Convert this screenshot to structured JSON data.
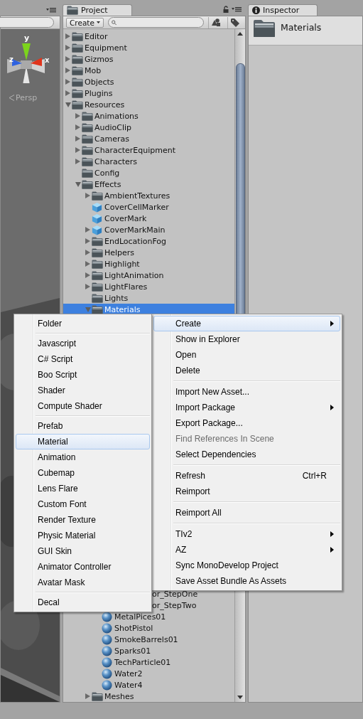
{
  "scene": {
    "axes": [
      {
        "label": "y"
      },
      {
        "label": "z"
      },
      {
        "label": "x"
      }
    ],
    "view_mode": "Persp"
  },
  "project": {
    "tab": "Project",
    "create_button": "Create",
    "tree": [
      {
        "name": "Editor",
        "kind": "folder",
        "expanded": false,
        "selected": false
      },
      {
        "name": "Equipment",
        "kind": "folder",
        "expanded": false,
        "selected": false
      },
      {
        "name": "Gizmos",
        "kind": "folder",
        "expanded": false,
        "selected": false
      },
      {
        "name": "Mob",
        "kind": "folder",
        "expanded": false,
        "selected": false
      },
      {
        "name": "Objects",
        "kind": "folder",
        "expanded": false,
        "selected": false
      },
      {
        "name": "Plugins",
        "kind": "folder",
        "expanded": false,
        "selected": false
      },
      {
        "name": "Resources",
        "kind": "folder",
        "expanded": true,
        "selected": false,
        "children": [
          {
            "name": "Animations",
            "kind": "folder",
            "expanded": false,
            "selected": false
          },
          {
            "name": "AudioClip",
            "kind": "folder",
            "expanded": false,
            "selected": false
          },
          {
            "name": "Cameras",
            "kind": "folder",
            "expanded": false,
            "selected": false
          },
          {
            "name": "CharacterEquipment",
            "kind": "folder",
            "expanded": false,
            "selected": false
          },
          {
            "name": "Characters",
            "kind": "folder",
            "expanded": false,
            "selected": false
          },
          {
            "name": "Config",
            "kind": "folder",
            "selected": false
          },
          {
            "name": "Effects",
            "kind": "folder",
            "expanded": true,
            "selected": false,
            "children": [
              {
                "name": "AmbientTextures",
                "kind": "folder",
                "expanded": false,
                "selected": false
              },
              {
                "name": "CoverCellMarker",
                "kind": "prefab",
                "selected": false
              },
              {
                "name": "CoverMark",
                "kind": "prefab",
                "selected": false
              },
              {
                "name": "CoverMarkMain",
                "kind": "prefab",
                "expanded": false,
                "selected": false
              },
              {
                "name": "EndLocationFog",
                "kind": "folder",
                "expanded": false,
                "selected": false
              },
              {
                "name": "Helpers",
                "kind": "folder",
                "expanded": false,
                "selected": false
              },
              {
                "name": "Highlight",
                "kind": "folder",
                "expanded": false,
                "selected": false
              },
              {
                "name": "LightAnimation",
                "kind": "folder",
                "expanded": false,
                "selected": false
              },
              {
                "name": "LightFlares",
                "kind": "folder",
                "expanded": false,
                "selected": false
              },
              {
                "name": "Lights",
                "kind": "folder",
                "selected": false
              },
              {
                "name": "Materials",
                "kind": "folder",
                "expanded": true,
                "selected": true,
                "children": [
                  {
                    "name": "or_StepOne",
                    "kind": "clipped",
                    "selected": false
                  },
                  {
                    "name": "or_StepTwo",
                    "kind": "clipped",
                    "selected": false
                  },
                  {
                    "name": "MetalPices01",
                    "kind": "material",
                    "selected": false
                  },
                  {
                    "name": "ShotPistol",
                    "kind": "material",
                    "selected": false
                  },
                  {
                    "name": "SmokeBarrels01",
                    "kind": "material",
                    "selected": false
                  },
                  {
                    "name": "Sparks01",
                    "kind": "material",
                    "selected": false
                  },
                  {
                    "name": "TechParticle01",
                    "kind": "material",
                    "selected": false
                  },
                  {
                    "name": "Water2",
                    "kind": "material",
                    "selected": false
                  },
                  {
                    "name": "Water4",
                    "kind": "material",
                    "selected": false
                  }
                ]
              },
              {
                "name": "Meshes",
                "kind": "folder",
                "expanded": false,
                "selected": false
              }
            ]
          }
        ]
      }
    ]
  },
  "inspector": {
    "tab": "Inspector",
    "title": "Materials"
  },
  "context_menu": {
    "items": [
      {
        "kind": "item",
        "label": "Create",
        "selected": true,
        "disabled": false,
        "submenu": true
      },
      {
        "kind": "item",
        "label": "Show in Explorer",
        "selected": false,
        "disabled": false
      },
      {
        "kind": "item",
        "label": "Open",
        "selected": false,
        "disabled": false
      },
      {
        "kind": "item",
        "label": "Delete",
        "selected": false,
        "disabled": false
      },
      {
        "kind": "separator"
      },
      {
        "kind": "item",
        "label": "Import New Asset...",
        "selected": false,
        "disabled": false
      },
      {
        "kind": "item",
        "label": "Import Package",
        "selected": false,
        "disabled": false,
        "submenu": true
      },
      {
        "kind": "item",
        "label": "Export Package...",
        "selected": false,
        "disabled": false
      },
      {
        "kind": "item",
        "label": "Find References In Scene",
        "selected": false,
        "disabled": true
      },
      {
        "kind": "item",
        "label": "Select Dependencies",
        "selected": false,
        "disabled": false
      },
      {
        "kind": "separator"
      },
      {
        "kind": "item",
        "label": "Refresh",
        "shortcut": "Ctrl+R",
        "selected": false,
        "disabled": false
      },
      {
        "kind": "item",
        "label": "Reimport",
        "selected": false,
        "disabled": false
      },
      {
        "kind": "separator"
      },
      {
        "kind": "item",
        "label": "Reimport All",
        "selected": false,
        "disabled": false
      },
      {
        "kind": "separator"
      },
      {
        "kind": "item",
        "label": "TIv2",
        "selected": false,
        "disabled": false,
        "submenu": true
      },
      {
        "kind": "item",
        "label": "AZ",
        "selected": false,
        "disabled": false,
        "submenu": true
      },
      {
        "kind": "item",
        "label": "Sync MonoDevelop Project",
        "selected": false,
        "disabled": false
      },
      {
        "kind": "item",
        "label": "Save Asset Bundle As Assets",
        "selected": false,
        "disabled": false
      }
    ]
  },
  "create_submenu": {
    "items": [
      {
        "kind": "item",
        "label": "Folder",
        "selected": false,
        "disabled": false
      },
      {
        "kind": "separator"
      },
      {
        "kind": "item",
        "label": "Javascript",
        "selected": false,
        "disabled": false
      },
      {
        "kind": "item",
        "label": "C# Script",
        "selected": false,
        "disabled": false
      },
      {
        "kind": "item",
        "label": "Boo Script",
        "selected": false,
        "disabled": false
      },
      {
        "kind": "item",
        "label": "Shader",
        "selected": false,
        "disabled": false
      },
      {
        "kind": "item",
        "label": "Compute Shader",
        "selected": false,
        "disabled": false
      },
      {
        "kind": "separator"
      },
      {
        "kind": "item",
        "label": "Prefab",
        "selected": false,
        "disabled": false
      },
      {
        "kind": "item",
        "label": "Material",
        "selected": true,
        "disabled": false
      },
      {
        "kind": "item",
        "label": "Animation",
        "selected": false,
        "disabled": false
      },
      {
        "kind": "item",
        "label": "Cubemap",
        "selected": false,
        "disabled": false
      },
      {
        "kind": "item",
        "label": "Lens Flare",
        "selected": false,
        "disabled": false
      },
      {
        "kind": "item",
        "label": "Custom Font",
        "selected": false,
        "disabled": false
      },
      {
        "kind": "item",
        "label": "Render Texture",
        "selected": false,
        "disabled": false
      },
      {
        "kind": "item",
        "label": "Physic Material",
        "selected": false,
        "disabled": false
      },
      {
        "kind": "item",
        "label": "GUI Skin",
        "selected": false,
        "disabled": false
      },
      {
        "kind": "item",
        "label": "Animator Controller",
        "selected": false,
        "disabled": false
      },
      {
        "kind": "item",
        "label": "Avatar Mask",
        "selected": false,
        "disabled": false
      },
      {
        "kind": "separator"
      },
      {
        "kind": "item",
        "label": "Decal",
        "selected": false,
        "disabled": false
      }
    ]
  }
}
